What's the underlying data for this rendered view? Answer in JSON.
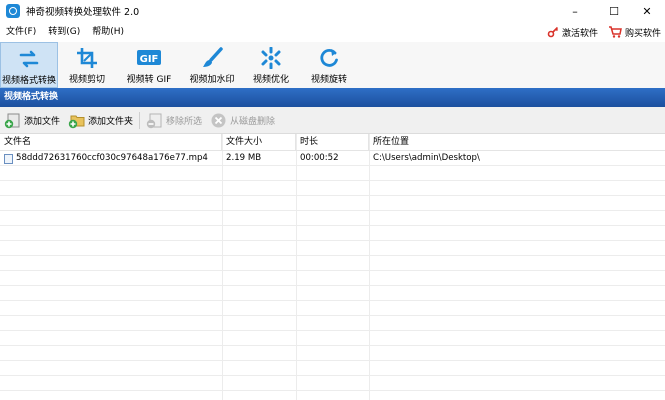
{
  "window": {
    "title": "神奇视频转换处理软件 2.0",
    "minimize": "–",
    "maximize": "☐",
    "close": "✕"
  },
  "menu": [
    "文件(F)",
    "转到(G)",
    "帮助(H)"
  ],
  "top_links": {
    "activate": "激活软件",
    "buy": "购买软件"
  },
  "toolbar": [
    {
      "label": "视频格式转换",
      "icon": "convert-icon",
      "active": true
    },
    {
      "label": "视频剪切",
      "icon": "crop-icon",
      "active": false
    },
    {
      "label": "视频转 GIF",
      "icon": "gif-icon",
      "active": false
    },
    {
      "label": "视频加水印",
      "icon": "brush-icon",
      "active": false
    },
    {
      "label": "视频优化",
      "icon": "optimize-icon",
      "active": false
    },
    {
      "label": "视频旋转",
      "icon": "rotate-icon",
      "active": false
    }
  ],
  "section_title": "视频格式转换",
  "actions": {
    "add_file": "添加文件",
    "add_folder": "添加文件夹",
    "remove_selected": "移除所选",
    "delete_from_disk": "从磁盘删除"
  },
  "table": {
    "headers": [
      "文件名",
      "文件大小",
      "时长",
      "所在位置"
    ],
    "rows": [
      {
        "name": "58ddd72631760ccf030c97648a176e77.mp4",
        "size": "2.19 MB",
        "duration": "00:00:52",
        "location": "C:\\Users\\admin\\Desktop\\"
      }
    ]
  },
  "colors": {
    "accent": "#1e88d6",
    "section_bg": "#2a63b8",
    "active_tool_bg": "#cfe3f5"
  }
}
